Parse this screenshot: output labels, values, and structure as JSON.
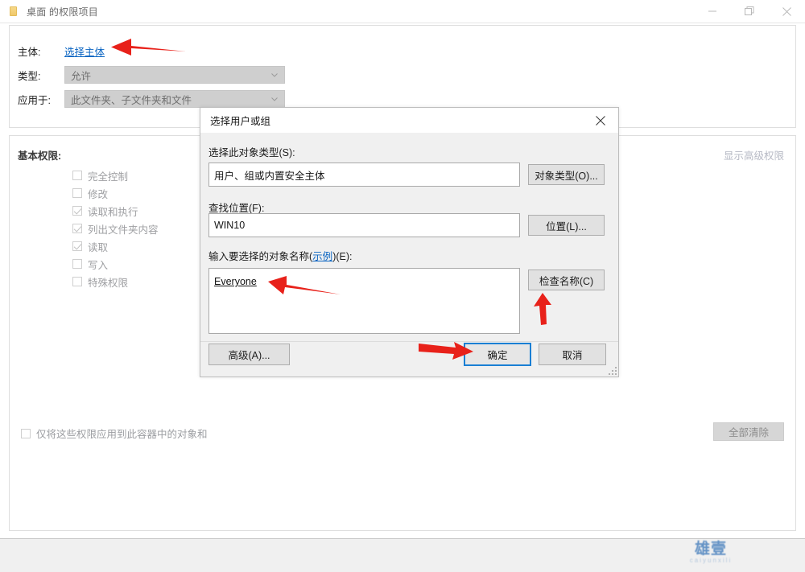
{
  "window": {
    "title": "桌面 的权限项目",
    "icon": "folder-icon",
    "controls": {
      "minimize": "minimize-icon",
      "maximize": "restore-icon",
      "close": "close-icon"
    }
  },
  "form": {
    "principal": {
      "label": "主体:",
      "link_text": "选择主体"
    },
    "type": {
      "label": "类型:",
      "value": "允许"
    },
    "apply_to": {
      "label": "应用于:",
      "value": "此文件夹、子文件夹和文件"
    }
  },
  "permissions": {
    "title": "基本权限:",
    "advanced_link": "显示高级权限",
    "items": [
      {
        "label": "完全控制",
        "checked": false
      },
      {
        "label": "修改",
        "checked": false
      },
      {
        "label": "读取和执行",
        "checked": true
      },
      {
        "label": "列出文件夹内容",
        "checked": true
      },
      {
        "label": "读取",
        "checked": true
      },
      {
        "label": "写入",
        "checked": false
      },
      {
        "label": "特殊权限",
        "checked": false
      }
    ],
    "container_only": {
      "label": "仅将这些权限应用到此容器中的对象和",
      "checked": false
    },
    "clear_all_button": "全部清除"
  },
  "watermark": {
    "main": "雄壹",
    "sub": "caiyunxili"
  },
  "dialog": {
    "title": "选择用户或组",
    "close_icon": "close-icon",
    "object_type": {
      "label": "选择此对象类型(S):",
      "value": "用户、组或内置安全主体",
      "button": "对象类型(O)..."
    },
    "location": {
      "label": "查找位置(F):",
      "value": "WIN10",
      "button": "位置(L)..."
    },
    "names": {
      "label_prefix": "输入要选择的对象名称(",
      "label_link": "示例",
      "label_suffix": ")(E):",
      "value": "Everyone",
      "check_button": "检查名称(C)"
    },
    "footer": {
      "advanced": "高级(A)...",
      "ok": "确定",
      "cancel": "取消"
    }
  },
  "annotations": {
    "color": "#e8211a",
    "arrows": [
      {
        "name": "arrow-to-select-principal"
      },
      {
        "name": "arrow-to-everyone-field"
      },
      {
        "name": "arrow-to-check-names-button"
      },
      {
        "name": "arrow-to-ok-button"
      }
    ]
  }
}
